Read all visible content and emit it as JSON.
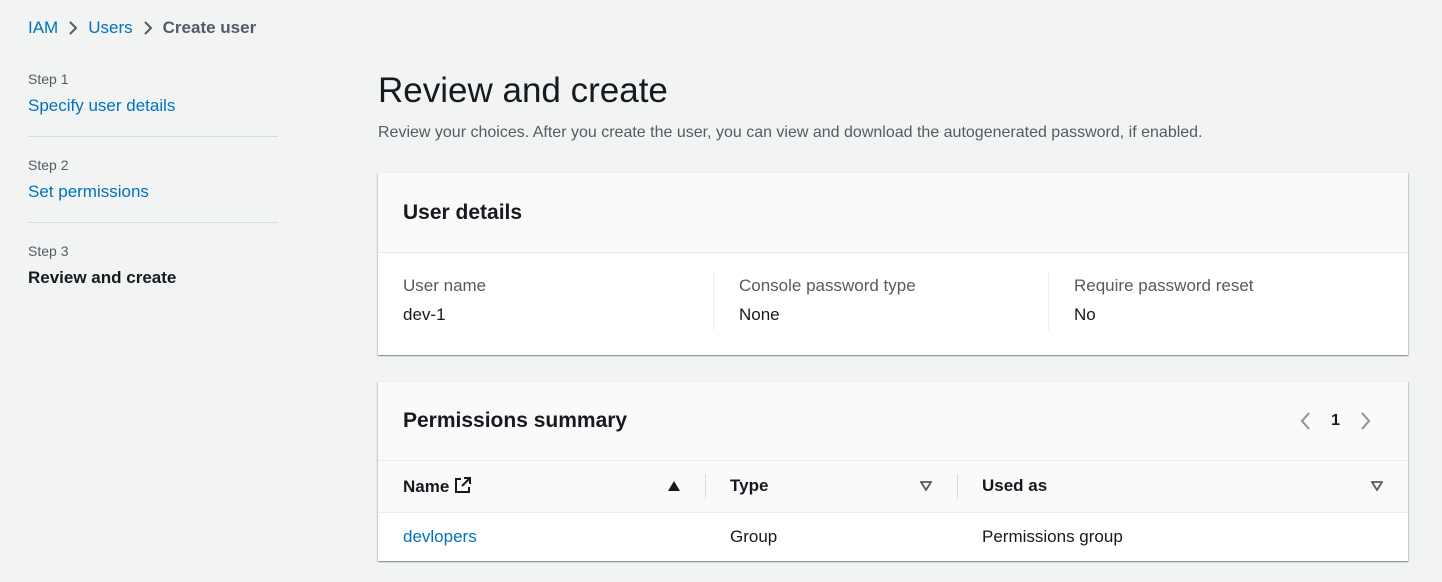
{
  "breadcrumb": [
    {
      "label": "IAM"
    },
    {
      "label": "Users"
    },
    {
      "label": "Create user"
    }
  ],
  "steps": [
    {
      "num": "Step 1",
      "title": "Specify user details",
      "active": false
    },
    {
      "num": "Step 2",
      "title": "Set permissions",
      "active": false
    },
    {
      "num": "Step 3",
      "title": "Review and create",
      "active": true
    }
  ],
  "page": {
    "title": "Review and create",
    "description": "Review your choices. After you create the user, you can view and download the autogenerated password, if enabled."
  },
  "user_details": {
    "title": "User details",
    "fields": [
      {
        "label": "User name",
        "value": "dev-1"
      },
      {
        "label": "Console password type",
        "value": "None"
      },
      {
        "label": "Require password reset",
        "value": "No"
      }
    ]
  },
  "permissions_summary": {
    "title": "Permissions summary",
    "page": "1",
    "columns": [
      "Name",
      "Type",
      "Used as"
    ],
    "rows": [
      {
        "name": "devlopers",
        "type": "Group",
        "used_as": "Permissions group"
      }
    ]
  },
  "colors": {
    "link": "#0073bb",
    "text": "#16191f",
    "muted": "#545b64",
    "background": "#f2f3f3"
  }
}
